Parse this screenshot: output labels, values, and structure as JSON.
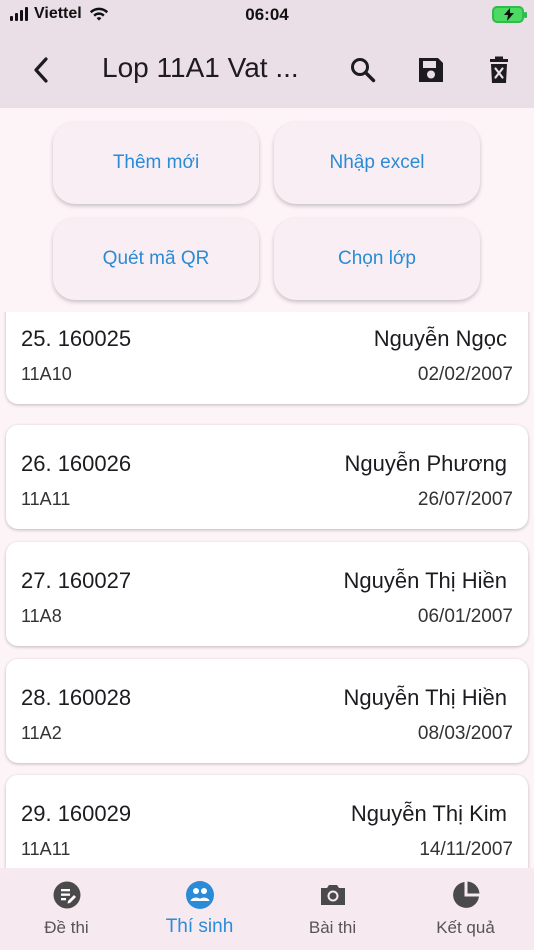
{
  "status_bar": {
    "carrier": "Viettel",
    "time": "06:04"
  },
  "app_bar": {
    "title": "Lop 11A1 Vat ...",
    "icons": [
      "back-arrow-icon",
      "search-icon",
      "save-icon",
      "delete-icon"
    ]
  },
  "actions": {
    "add_new": "Thêm mới",
    "import_excel": "Nhập excel",
    "scan_qr": "Quét mã QR",
    "choose_class": "Chọn lớp"
  },
  "students": [
    {
      "id": "25. 160025",
      "name": "Nguyễn Ngọc",
      "class": "11A10",
      "dob": "02/02/2007"
    },
    {
      "id": "26. 160026",
      "name": "Nguyễn Phương",
      "class": "11A11",
      "dob": "26/07/2007"
    },
    {
      "id": "27. 160027",
      "name": "Nguyễn Thị Hiền",
      "class": "11A8",
      "dob": "06/01/2007"
    },
    {
      "id": "28. 160028",
      "name": "Nguyễn Thị Hiền",
      "class": "11A2",
      "dob": "08/03/2007"
    },
    {
      "id": "29. 160029",
      "name": "Nguyễn Thị Kim",
      "class": "11A11",
      "dob": "14/11/2007"
    }
  ],
  "bottom_nav": {
    "items": [
      {
        "label": "Đề thi",
        "icon": "exam-icon"
      },
      {
        "label": "Thí sinh",
        "icon": "candidates-icon"
      },
      {
        "label": "Bài thi",
        "icon": "camera-icon"
      },
      {
        "label": "Kết quả",
        "icon": "pie-chart-icon"
      }
    ],
    "active_index": 1
  },
  "colors": {
    "accent": "#2a8bd6",
    "app_bar_bg": "#ebdfe7",
    "page_bg": "#fdf4f7",
    "battery": "#4cd964"
  }
}
